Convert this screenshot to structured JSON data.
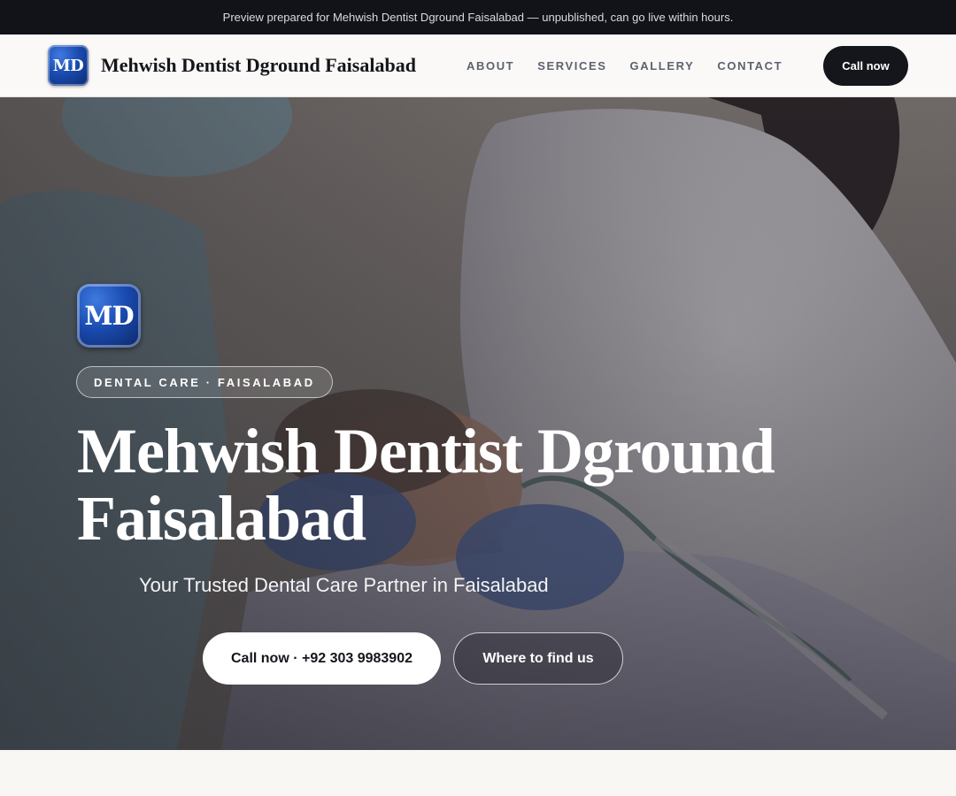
{
  "announcement": "Preview prepared for Mehwish Dentist Dground Faisalabad — unpublished, can go live within hours.",
  "header": {
    "logo_text": "MD",
    "brand": "Mehwish Dentist Dground Faisalabad",
    "nav": [
      "ABOUT",
      "SERVICES",
      "GALLERY",
      "CONTACT"
    ],
    "cta": "Call now"
  },
  "hero": {
    "logo_text": "MD",
    "eyebrow": "DENTAL CARE · FAISALABAD",
    "title_line1": "Mehwish Dentist Dground",
    "title_line2": "Faisalabad",
    "subtitle": "Your Trusted Dental Care Partner in Faisalabad",
    "primary_button": "Call now · +92 303 9983902",
    "secondary_button": "Where to find us"
  },
  "colors": {
    "dark": "#14161b",
    "logo_blue": "#1a4bb0",
    "page_bg": "#f8f7f4"
  }
}
